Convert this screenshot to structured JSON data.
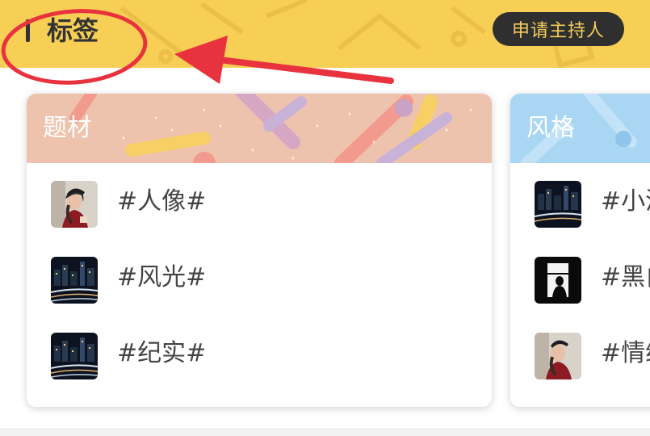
{
  "header": {
    "title": "标签",
    "apply_button": "申请主持人"
  },
  "colors": {
    "header_bg": "#f8cf55",
    "button_bg": "#2f2f2f",
    "button_text": "#f3cd5a",
    "card1_head": "#eec3ad",
    "card2_head": "#a9d6f3",
    "annotation": "#e8333f"
  },
  "cards": [
    {
      "title": "题材",
      "items": [
        {
          "label": "#人像#",
          "thumb": "portrait-thumbnail"
        },
        {
          "label": "#风光#",
          "thumb": "night-cityscape-thumbnail"
        },
        {
          "label": "#纪实#",
          "thumb": "night-cityscape-thumbnail"
        }
      ]
    },
    {
      "title": "风格",
      "items": [
        {
          "label": "#小清",
          "thumb": "night-cityscape-thumbnail"
        },
        {
          "label": "#黑白",
          "thumb": "window-silhouette-thumbnail"
        },
        {
          "label": "#情绪",
          "thumb": "portrait-thumbnail"
        }
      ]
    }
  ]
}
